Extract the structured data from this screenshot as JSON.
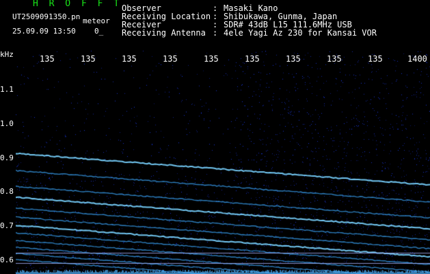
{
  "header": {
    "brand": "H R O F F T",
    "filename": "UT2509091350.pn",
    "mode_label": "meteor",
    "timestamp": "25.09.09 13:50",
    "count": "0_",
    "fields": [
      {
        "label": "Observer",
        "value": "Masaki Kano"
      },
      {
        "label": "Receiving Location",
        "value": "Shibukawa, Gunma, Japan"
      },
      {
        "label": "Receiver",
        "value": "SDR# 43dB L15 111.6MHz USB"
      },
      {
        "label": "Receiving Antenna",
        "value": "4ele Yagi Az 230 for Kansai VOR"
      }
    ],
    "colon": ":"
  },
  "axes": {
    "y_unit": "kHz",
    "y_ticks": [
      "1.1",
      "1.0",
      "0.9",
      "0.8",
      "0.7",
      "0.6"
    ],
    "x_ticks": [
      "135",
      "135",
      "135",
      "135",
      "135",
      "135",
      "135",
      "135",
      "135",
      "1400"
    ]
  },
  "colors": {
    "background": "#000000",
    "brand": "#19e619",
    "text": "#ffffff",
    "noise": "#1a2fcf",
    "trace": "#3fb4ff",
    "divider": "#9aa8ff"
  }
}
